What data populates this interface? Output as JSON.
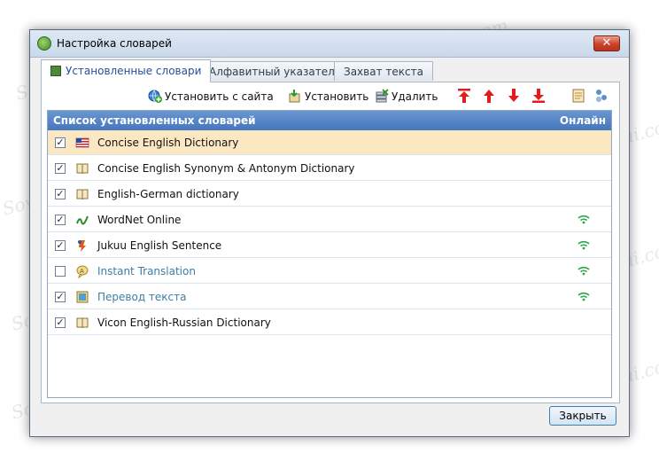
{
  "window": {
    "title": "Настройка словарей",
    "close_label": "✕"
  },
  "tabs": [
    {
      "label": "Установленные словари",
      "active": true
    },
    {
      "label": "Алфавитный указатель",
      "active": false
    },
    {
      "label": "Захват текста",
      "active": false
    }
  ],
  "toolbar": {
    "install_from_site": "Установить с сайта",
    "install": "Установить",
    "delete": "Удалить"
  },
  "list": {
    "header_name": "Список установленных словарей",
    "header_online": "Онлайн",
    "rows": [
      {
        "label": "Concise English Dictionary",
        "checked": true,
        "online": false,
        "icon": "flag-us-icon",
        "selected": true
      },
      {
        "label": "Concise English Synonym & Antonym Dictionary",
        "checked": true,
        "online": false,
        "icon": "book-icon"
      },
      {
        "label": "English-German dictionary",
        "checked": true,
        "online": false,
        "icon": "book-icon"
      },
      {
        "label": "WordNet Online",
        "checked": true,
        "online": true,
        "icon": "wordnet-icon"
      },
      {
        "label": "Jukuu English Sentence",
        "checked": true,
        "online": true,
        "icon": "jukuu-icon"
      },
      {
        "label": "Instant Translation",
        "checked": false,
        "online": true,
        "icon": "translate-bubble-icon",
        "dim": true
      },
      {
        "label": "Перевод текста",
        "checked": true,
        "online": true,
        "icon": "text-translate-icon",
        "dim": true
      },
      {
        "label": "Vicon English-Russian Dictionary",
        "checked": true,
        "online": false,
        "icon": "book-icon"
      }
    ]
  },
  "close_button": "Закрыть",
  "watermark": "Sovinetpertui.com",
  "colors": {
    "header": "#4577bd",
    "selected_row": "#fbe8c3",
    "online": "#2aa844",
    "arrow": "#e31b1b"
  }
}
